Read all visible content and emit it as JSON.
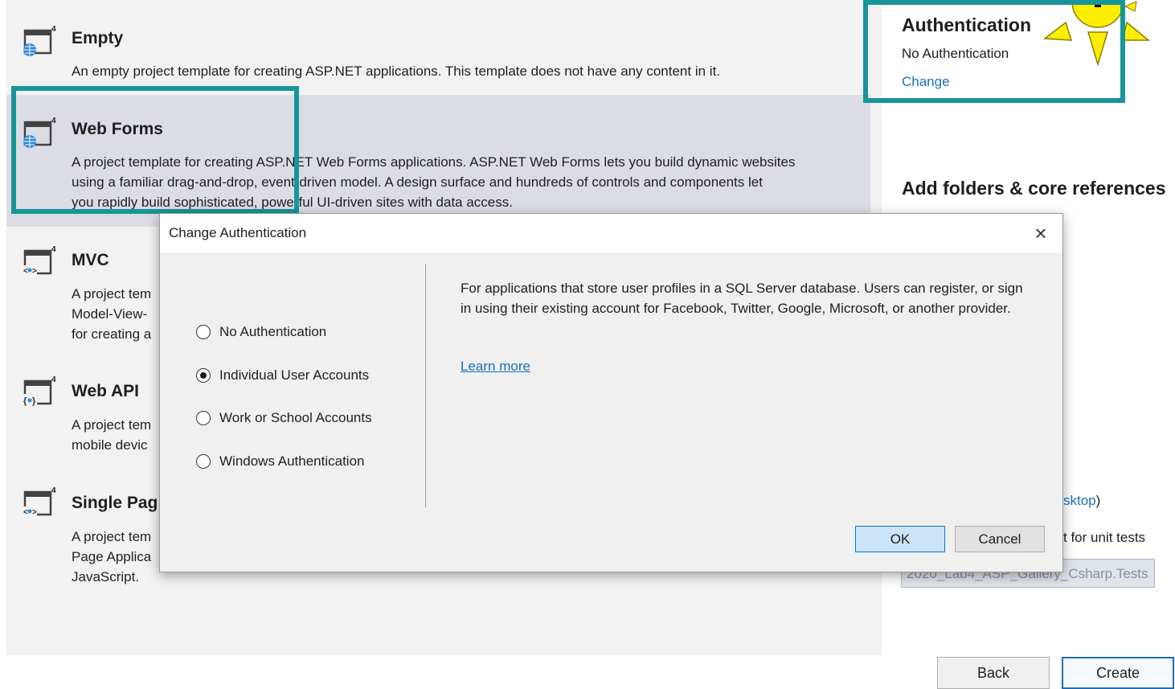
{
  "templates": [
    {
      "title": "Empty",
      "desc": [
        "An empty project template for creating ASP.NET applications. This template does not have any content in it."
      ]
    },
    {
      "title": "Web Forms",
      "desc": [
        "A project template for creating ASP.NET Web Forms applications. ASP.NET Web Forms lets you build dynamic websites",
        "using a familiar drag-and-drop, event-driven model. A design surface and hundreds of controls and components let",
        "you rapidly build sophisticated, powerful UI-driven sites with data access."
      ]
    },
    {
      "title": "MVC",
      "desc": [
        "A project tem",
        "Model-View-",
        "for creating a"
      ]
    },
    {
      "title": "Web API",
      "desc": [
        "A project tem",
        "mobile devic"
      ]
    },
    {
      "title": "Single Pag",
      "desc": [
        "A project tem",
        "Page Applica",
        "JavaScript."
      ]
    }
  ],
  "authentication": {
    "heading": "Authentication",
    "value": "No Authentication",
    "change_link": "Change"
  },
  "folders_heading": "Add folders & core references",
  "fragments": {
    "link_text": "sktop",
    "link_paren": ")",
    "unit_tests": "t for unit tests",
    "tests_project_name": "2020_Lab4_ASP_Gallery_Csharp.Tests"
  },
  "footer": {
    "back_label": "Back",
    "create_label": "Create"
  },
  "dialog": {
    "title": "Change Authentication",
    "options": [
      "No Authentication",
      "Individual User Accounts",
      "Work or School Accounts",
      "Windows Authentication"
    ],
    "selected_option": "Individual User Accounts",
    "description": "For applications that store user profiles in a SQL Server database. Users can register, or sign in using their existing account for Facebook, Twitter, Google, Microsoft, or another provider.",
    "learn_more": "Learn more",
    "ok_label": "OK",
    "cancel_label": "Cancel"
  },
  "colors": {
    "highlight": "#17959a",
    "link": "#1a6fb8",
    "sun": "#ffee00",
    "selected_row": "#dcdde4"
  }
}
